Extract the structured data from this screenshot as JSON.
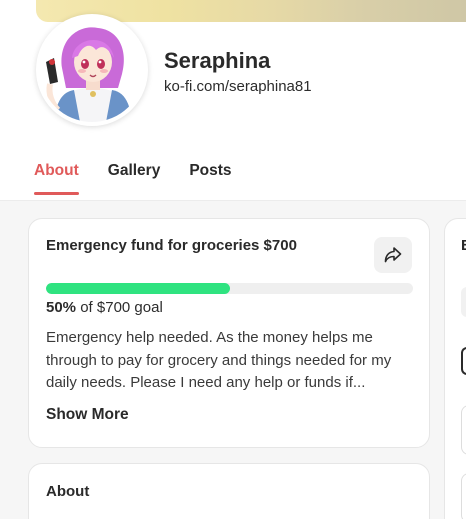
{
  "profile": {
    "name": "Seraphina",
    "link": "ko-fi.com/seraphina81"
  },
  "tabs": [
    {
      "label": "About",
      "active": true
    },
    {
      "label": "Gallery",
      "active": false
    },
    {
      "label": "Posts",
      "active": false
    }
  ],
  "goal": {
    "title": "Emergency fund for groceries $700",
    "percent_label": "50%",
    "of_label": "of $700 goal",
    "progress_fraction": 0.5,
    "description": "Emergency help needed. As the money helps me through to pay for grocery and things needed for my daily needs. Please I need any help or funds if...",
    "show_more_label": "Show More",
    "share_icon": "share-arrow-icon"
  },
  "about": {
    "title": "About"
  },
  "side_panel": {
    "letter": "B"
  },
  "colors": {
    "accent": "#e05a5a",
    "progress": "#2fe380",
    "background": "#f6f6f6"
  }
}
